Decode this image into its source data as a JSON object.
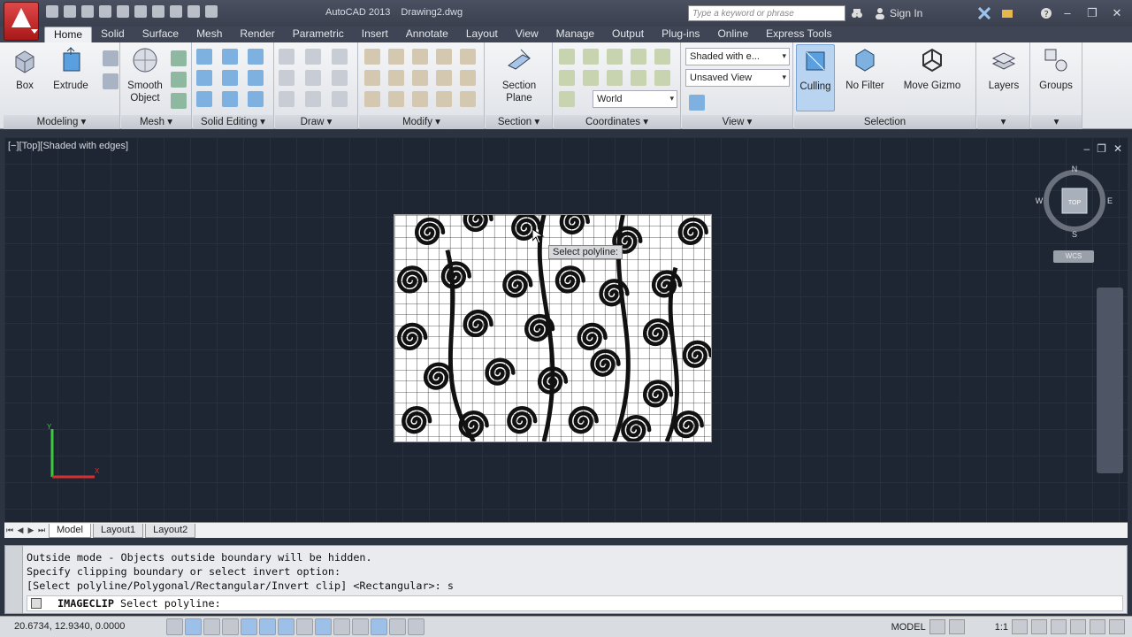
{
  "app": {
    "title": "AutoCAD 2013",
    "document": "Drawing2.dwg",
    "search_placeholder": "Type a keyword or phrase",
    "sign_in": "Sign In",
    "accent_color": "#c42020"
  },
  "tabs": [
    "Home",
    "Solid",
    "Surface",
    "Mesh",
    "Render",
    "Parametric",
    "Insert",
    "Annotate",
    "Layout",
    "View",
    "Manage",
    "Output",
    "Plug-ins",
    "Online",
    "Express Tools"
  ],
  "active_tab": "Home",
  "ribbon": {
    "modeling": {
      "title": "Modeling",
      "box": "Box",
      "extrude": "Extrude"
    },
    "mesh": {
      "title": "Mesh",
      "smooth_object_1": "Smooth",
      "smooth_object_2": "Object"
    },
    "solid_editing": {
      "title": "Solid Editing"
    },
    "draw": {
      "title": "Draw"
    },
    "modify": {
      "title": "Modify"
    },
    "section": {
      "title": "Section",
      "section_plane_1": "Section",
      "section_plane_2": "Plane"
    },
    "coordinates": {
      "title": "Coordinates",
      "ucs_value": "World"
    },
    "view": {
      "title": "View",
      "visual_style": "Shaded with e...",
      "named_view": "Unsaved View"
    },
    "selection": {
      "title": "Selection",
      "culling": "Culling",
      "no_filter": "No Filter",
      "move_gizmo": "Move Gizmo"
    },
    "layers": {
      "label": "Layers"
    },
    "groups": {
      "label": "Groups"
    }
  },
  "viewport": {
    "label": "[−][Top][Shaded with edges]",
    "tooltip": "Select polyline:",
    "viewcube": {
      "top": "TOP",
      "n": "N",
      "s": "S",
      "e": "E",
      "w": "W",
      "wcs": "WCS"
    }
  },
  "layout_tabs": [
    "Model",
    "Layout1",
    "Layout2"
  ],
  "active_layout": "Model",
  "command": {
    "history": [
      "Outside mode - Objects outside boundary will be hidden.",
      "Specify clipping boundary or select invert option:",
      "[Select polyline/Polygonal/Rectangular/Invert clip] <Rectangular>: s"
    ],
    "current_cmd": "IMAGECLIP",
    "current_prompt": "Select polyline:"
  },
  "status": {
    "coords": "20.6734, 12.9340, 0.0000",
    "model": "MODEL",
    "scale": "1:1"
  }
}
